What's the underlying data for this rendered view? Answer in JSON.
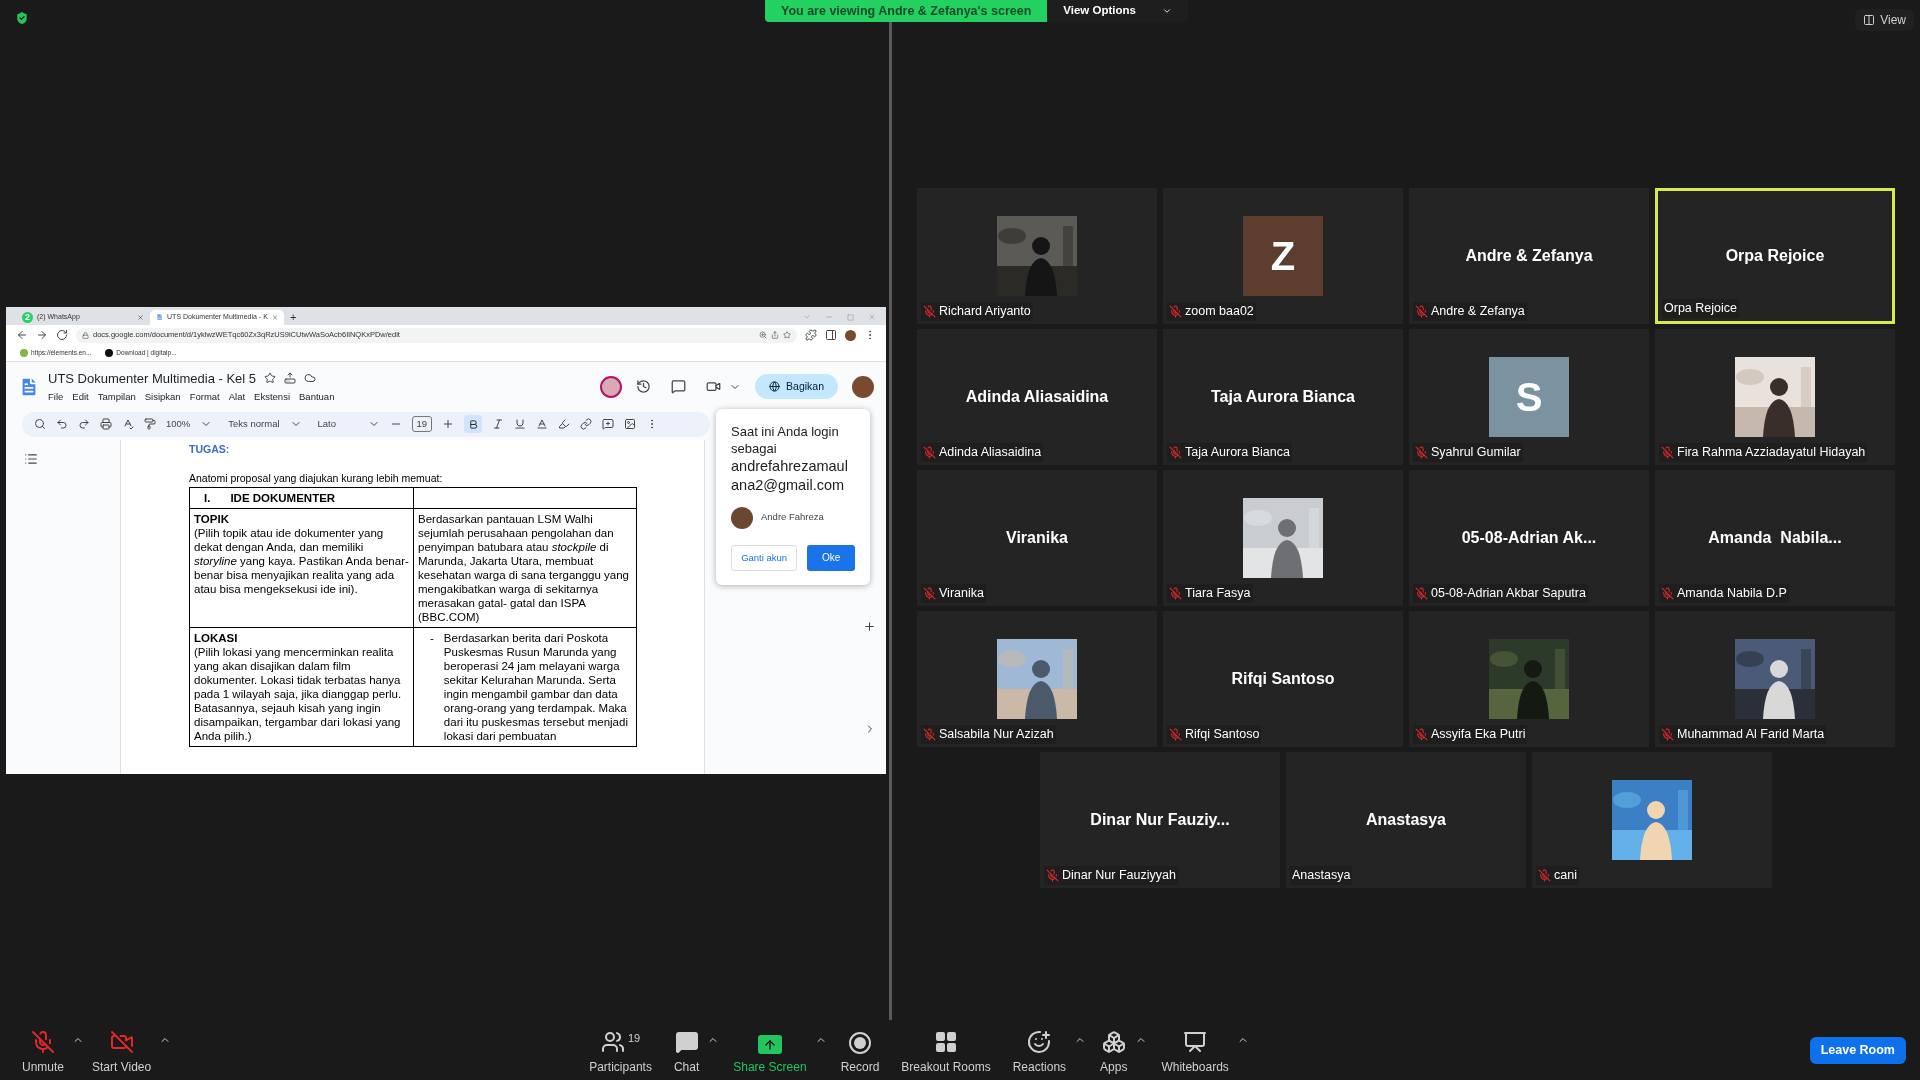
{
  "top_bar": {
    "banner": "You are viewing Andre & Zefanya's screen",
    "view_options": "View Options",
    "view_button": "View"
  },
  "shared_screen": {
    "browser_tabs": [
      {
        "kind": "whatsapp",
        "badge": "2",
        "title": "(2) WhatsApp",
        "selected": false
      },
      {
        "kind": "docs",
        "title": "UTS Dokumenter Multimedia - K",
        "selected": true
      }
    ],
    "new_tab": "+",
    "url": "docs.google.com/document/d/1yklwzWETqc60Zx3qRzUS9iCUtwWaSoAcb6IlNQKxPDw/edit",
    "bookmarks": [
      {
        "kind": "leaf",
        "label": "https://elements.en..."
      },
      {
        "kind": "disc",
        "label": "Download | digitalp..."
      }
    ],
    "doc_title": "UTS Dokumenter Multimedia - Kel 5",
    "menus": [
      "File",
      "Edit",
      "Tampilan",
      "Sisipkan",
      "Format",
      "Alat",
      "Ekstensi",
      "Bantuan"
    ],
    "share_button": "Bagikan",
    "toolbar": {
      "zoom": "100%",
      "style": "Teks normal",
      "font": "Lato",
      "font_size": "19",
      "bold": true
    },
    "document": {
      "heading": "TUGAS:",
      "intro": "Anatomi proposal yang diajukan kurang lebih memuat:",
      "table": {
        "section_number": "I.",
        "section_title": "IDE DOKUMENTER",
        "rows": [
          {
            "kind": "text",
            "title": "TOPIK",
            "description": "(Pilih topik atau ide dokumenter yang dekat dengan Anda, dan memiliki *storyline* yang kaya. Pastikan Anda benar-benar bisa menyajikan realita yang ada atau bisa mengeksekusi ide ini).",
            "content": "Berdasarkan pantauan LSM Walhi sejumlah perusahaan pengolahan dan penyimpan batubara atau *stockpile* di Marunda, Jakarta Utara, membuat kesehatan warga di sana terganggu yang mengakibatkan warga di sekitarnya merasakan gatal- gatal dan ISPA (BBC.COM)"
          },
          {
            "kind": "list",
            "title": "LOKASI",
            "description": "(Pilih lokasi yang mencerminkan realita yang akan disajikan dalam film dokumenter. Lokasi tidak terbatas hanya pada 1 wilayah saja, jika dianggap perlu. Batasannya, sejauh kisah yang ingin disampaikan, tergambar dari lokasi yang Anda pilih.)",
            "bullet": "-",
            "content": "Berdasarkan berita dari Poskota Puskesmas Rusun Marunda yang beroperasi 24 jam melayani warga sekitar Kelurahan Marunda. Serta ingin mengambil gambar dan data orang-orang yang terdampak. Maka dari itu puskesmas tersebut menjadi lokasi dari pembuatan"
          }
        ]
      }
    },
    "account_popup": {
      "message": "Saat ini Anda login sebagai",
      "email": "andrefahrezamaulana2@gmail.com",
      "account_name": "Andre Fahreza",
      "switch_button": "Ganti akun",
      "ok_button": "Oke"
    }
  },
  "participants": [
    {
      "kind": "picture",
      "label": "Richard Ariyanto",
      "muted": true,
      "active_speaker": false
    },
    {
      "kind": "letter",
      "avatar": "Z",
      "color": "#5c3d2e",
      "label": "zoom baa02",
      "muted": true,
      "active_speaker": false
    },
    {
      "kind": "name",
      "display_name": "Andre & Zefanya",
      "label": "Andre & Zefanya",
      "muted": true,
      "active_speaker": false
    },
    {
      "kind": "name",
      "display_name": "Orpa Rejoice",
      "label": "Orpa Rejoice",
      "muted": false,
      "active_speaker": true
    },
    {
      "kind": "name",
      "display_name": "Adinda Aliasaidina",
      "label": "Adinda Aliasaidina",
      "muted": true,
      "active_speaker": false
    },
    {
      "kind": "name",
      "display_name": "Taja Aurora Bianca",
      "label": "Taja Aurora Bianca",
      "muted": true,
      "active_speaker": false
    },
    {
      "kind": "letter",
      "avatar": "S",
      "color": "#7b93a1",
      "label": "Syahrul Gumilar",
      "muted": true,
      "active_speaker": false
    },
    {
      "kind": "picture",
      "label": "Fira Rahma Azziadayatul Hidayah",
      "muted": true,
      "active_speaker": false
    },
    {
      "kind": "name",
      "display_name": "Viranika",
      "label": "Viranika",
      "muted": true,
      "active_speaker": false
    },
    {
      "kind": "picture",
      "label": "Tiara Fasya",
      "muted": true,
      "active_speaker": false
    },
    {
      "kind": "name",
      "display_name": "05-08-Adrian Ak...",
      "label": "05-08-Adrian Akbar Saputra",
      "muted": true,
      "active_speaker": false
    },
    {
      "kind": "name",
      "display_name": "Amanda  Nabila...",
      "label": "Amanda Nabila D.P",
      "muted": true,
      "active_speaker": false
    },
    {
      "kind": "picture",
      "label": "Salsabila Nur Azizah",
      "muted": true,
      "active_speaker": false
    },
    {
      "kind": "name",
      "display_name": "Rifqi Santoso",
      "label": "Rifqi Santoso",
      "muted": true,
      "active_speaker": false
    },
    {
      "kind": "picture",
      "label": "Assyifa Eka Putri",
      "muted": true,
      "active_speaker": false
    },
    {
      "kind": "picture",
      "label": "Muhammad Al Farid Marta",
      "muted": true,
      "active_speaker": false
    },
    {
      "kind": "name",
      "display_name": "Dinar Nur Fauziy...",
      "label": "Dinar Nur Fauziyyah",
      "muted": true,
      "active_speaker": false
    },
    {
      "kind": "name",
      "display_name": "Anastasya",
      "label": "Anastasya",
      "muted": false,
      "active_speaker": false
    },
    {
      "kind": "picture",
      "label": "cani",
      "muted": true,
      "active_speaker": false
    }
  ],
  "meeting_controls": [
    {
      "kind": "mic",
      "label": "Unmute",
      "off": true,
      "menu": true
    },
    {
      "kind": "video",
      "label": "Start Video",
      "off": true,
      "menu": true
    },
    {
      "kind": "participants",
      "label": "Participants",
      "count": "19",
      "menu": false
    },
    {
      "kind": "chat",
      "label": "Chat",
      "menu": true
    },
    {
      "kind": "share",
      "label": "Share Screen",
      "menu": true
    },
    {
      "kind": "record",
      "label": "Record",
      "menu": false
    },
    {
      "kind": "breakout",
      "label": "Breakout Rooms",
      "menu": false
    },
    {
      "kind": "reactions",
      "label": "Reactions",
      "menu": true
    },
    {
      "kind": "apps",
      "label": "Apps",
      "menu": true
    },
    {
      "kind": "whiteboards",
      "label": "Whiteboards",
      "menu": true
    }
  ],
  "leave_button": "Leave Room"
}
